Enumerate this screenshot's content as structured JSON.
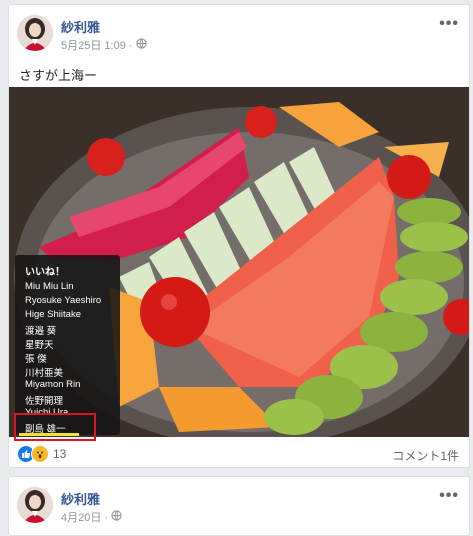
{
  "post1": {
    "author": "紗利雅",
    "timestamp": "5月25日 1:09 ·",
    "privacy_icon": "globe-icon",
    "text": "さすが上海ー",
    "image_subject": "fruit platter",
    "likes_tooltip": {
      "title": "いいね！",
      "names": [
        "Miu Miu Lin",
        "Ryosuke Yaeshiro",
        "Hige Shiitake",
        "渡邉 葵",
        "星野天",
        "張 傑",
        "川村亜美",
        "Miyamon Rin",
        "佐野開理",
        "Yuichi Ura",
        "副島 雄一"
      ]
    },
    "reactions": {
      "count": "13",
      "icons": [
        "like-icon",
        "wow-icon"
      ]
    },
    "comments_label": "コメント1件"
  },
  "post2": {
    "author": "紗利雅",
    "timestamp": "4月20日 ·"
  },
  "colors": {
    "link": "#385898",
    "highlight": "#e0141e",
    "marker": "#f2e33a"
  }
}
